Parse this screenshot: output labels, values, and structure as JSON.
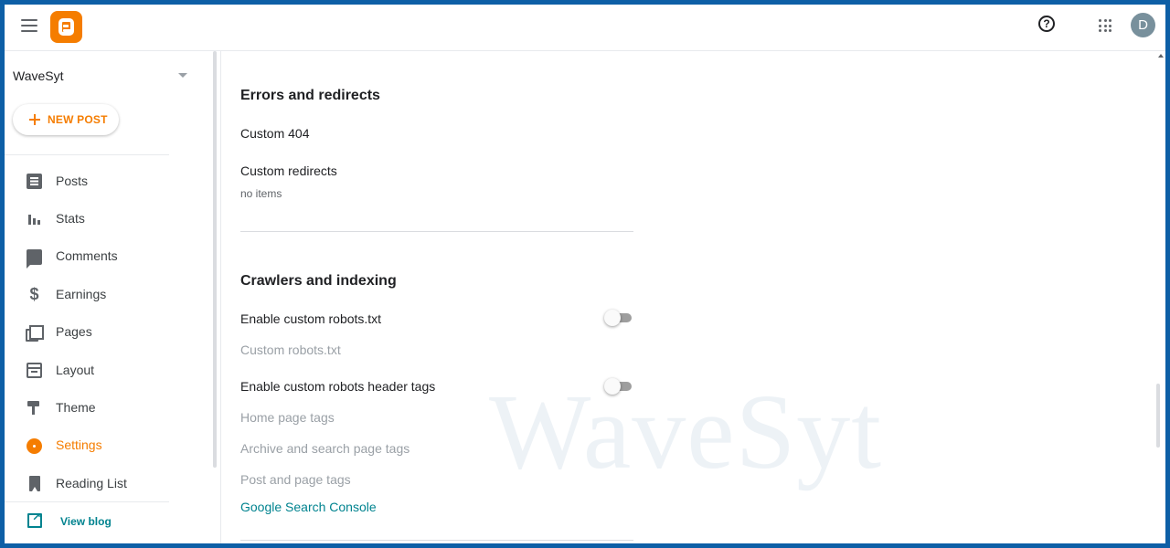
{
  "header": {
    "menu_icon": "hamburger-menu-icon",
    "logo_icon": "blogger-logo-icon",
    "help_icon": "help-circle-icon",
    "apps_icon": "apps-grid-icon",
    "avatar_letter": "D",
    "brand_color": "#f57d00",
    "avatar_color": "#78909c"
  },
  "sidebar": {
    "blog_name": "WaveSyt",
    "new_post_label": "NEW POST",
    "items": [
      {
        "label": "Posts",
        "icon": "posts-icon"
      },
      {
        "label": "Stats",
        "icon": "stats-icon"
      },
      {
        "label": "Comments",
        "icon": "comments-icon"
      },
      {
        "label": "Earnings",
        "icon": "dollar-icon"
      },
      {
        "label": "Pages",
        "icon": "pages-icon"
      },
      {
        "label": "Layout",
        "icon": "layout-icon"
      },
      {
        "label": "Theme",
        "icon": "paint-roller-icon"
      },
      {
        "label": "Settings",
        "icon": "gear-icon",
        "active": true
      },
      {
        "label": "Reading List",
        "icon": "bookmark-icon"
      }
    ],
    "view_blog_label": "View blog",
    "link_color": "#00838f"
  },
  "main": {
    "errors": {
      "title": "Errors and redirects",
      "custom_404": "Custom 404",
      "custom_redirects": "Custom redirects",
      "redirects_sub": "no items"
    },
    "crawlers": {
      "title": "Crawlers and indexing",
      "enable_robots_txt": "Enable custom robots.txt",
      "custom_robots_txt": "Custom robots.txt",
      "enable_robots_header": "Enable custom robots header tags",
      "home_page_tags": "Home page tags",
      "archive_search_tags": "Archive and search page tags",
      "post_page_tags": "Post and page tags",
      "search_console": "Google Search Console",
      "robots_txt_enabled": false,
      "robots_header_enabled": false
    },
    "watermark": "WaveSyt"
  }
}
